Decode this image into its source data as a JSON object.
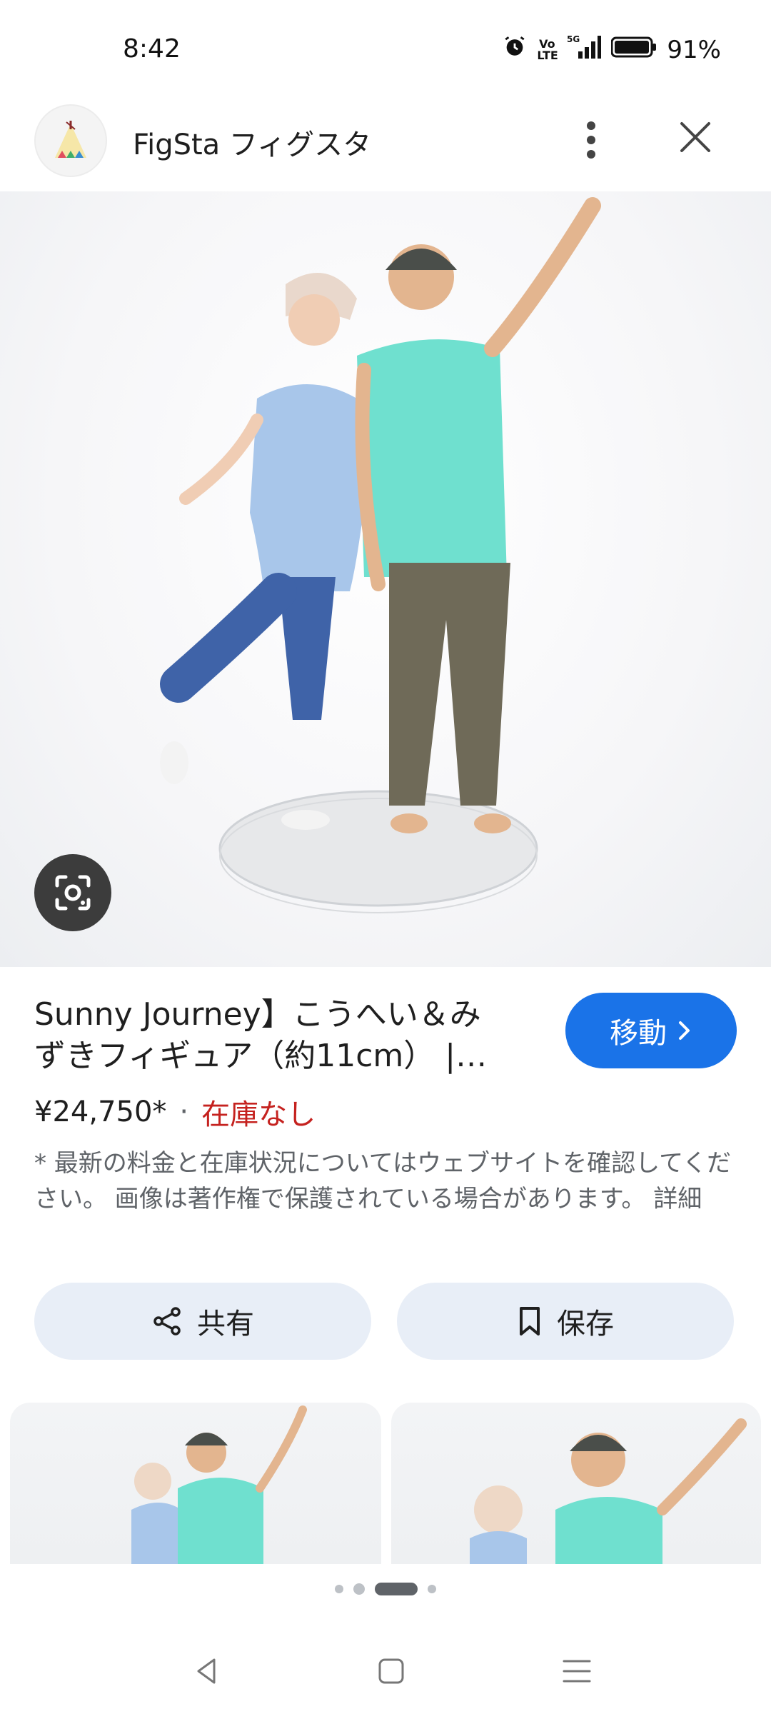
{
  "status_bar": {
    "time": "8:42",
    "battery_percent": "91%",
    "network": "5G",
    "volte": "Vo LTE"
  },
  "header": {
    "site_name": "FigSta フィグスタ"
  },
  "product": {
    "title_line1": "Sunny Journey】こうへい＆み",
    "title_line2": "ずきフィギュア（約11cm） |…",
    "goto_label": "移動",
    "price": "¥24,750*",
    "separator": "·",
    "stock": "在庫なし",
    "disclaimer": "* 最新の料金と在庫状況についてはウェブサイトを確認してください。 画像は著作権で保護されている場合があります。 詳細"
  },
  "actions": {
    "share_label": "共有",
    "save_label": "保存"
  },
  "pager": {
    "count": 4,
    "active_index": 2
  },
  "colors": {
    "accent": "#1a73e8",
    "stock_out": "#c5221f",
    "action_bg": "#e8eef7"
  },
  "icons": {
    "alarm": "alarm-icon",
    "signal": "signal-icon",
    "battery": "battery-icon",
    "more": "more-vert-icon",
    "close": "close-icon",
    "lens": "lens-icon",
    "share": "share-icon",
    "bookmark": "bookmark-icon",
    "chevron": "chevron-right-icon",
    "back": "back-icon",
    "home": "home-icon",
    "menu": "menu-icon"
  }
}
